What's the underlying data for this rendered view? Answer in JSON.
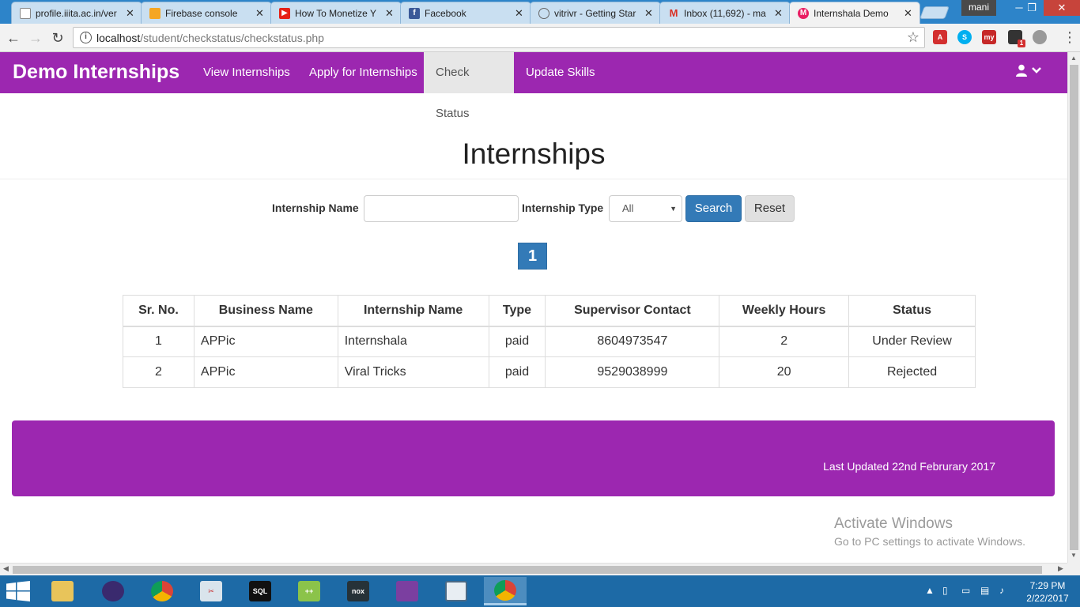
{
  "browser": {
    "tabs": [
      {
        "title": "profile.iiita.ac.in/ver",
        "icon": "page-icon",
        "active": false
      },
      {
        "title": "Firebase console",
        "icon": "firebase-icon",
        "active": false
      },
      {
        "title": "How To Monetize Y",
        "icon": "youtube-icon",
        "active": false
      },
      {
        "title": "Facebook",
        "icon": "facebook-icon",
        "active": false
      },
      {
        "title": "vitrivr - Getting Star",
        "icon": "search-icon",
        "active": false
      },
      {
        "title": "Inbox (11,692) - ma",
        "icon": "gmail-icon",
        "active": false
      },
      {
        "title": "Internshala Demo",
        "icon": "internshala-icon",
        "active": true
      }
    ],
    "user_chip": "mani",
    "url_host": "localhost",
    "url_path": "/student/checkstatus/checkstatus.php",
    "extension_badge": "1"
  },
  "navbar": {
    "brand": "Demo Internships",
    "links": [
      {
        "label": "View Internships",
        "active": false
      },
      {
        "label": "Apply for Internships",
        "active": false
      },
      {
        "label": "Check Status",
        "active": true
      },
      {
        "label": "Update Skills",
        "active": false
      }
    ]
  },
  "main": {
    "title": "Internships",
    "filter": {
      "name_label": "Internship Name",
      "name_value": "",
      "type_label": "Internship Type",
      "type_selected": "All",
      "search_label": "Search",
      "reset_label": "Reset"
    },
    "pagination": {
      "current_page": "1"
    },
    "table": {
      "headers": [
        "Sr. No.",
        "Business Name",
        "Internship Name",
        "Type",
        "Supervisor Contact",
        "Weekly Hours",
        "Status"
      ],
      "rows": [
        [
          "1",
          "APPic",
          "Internshala",
          "paid",
          "8604973547",
          "2",
          "Under Review"
        ],
        [
          "2",
          "APPic",
          "Viral Tricks",
          "paid",
          "9529038999",
          "20",
          "Rejected"
        ]
      ]
    }
  },
  "footer": {
    "text": "Last Updated 22nd Februrary 2017"
  },
  "watermark": {
    "title": "Activate Windows",
    "subtitle": "Go to PC settings to activate Windows."
  },
  "taskbar": {
    "time": "7:29 PM",
    "date": "2/22/2017",
    "apps": [
      "file-explorer-icon",
      "eclipse-icon",
      "chrome-icon",
      "snipping-tool-icon",
      "mysql-icon",
      "notepad-plus-plus-icon",
      "nox-icon",
      "winrar-icon",
      "reader-icon",
      "chrome-user-icon"
    ]
  },
  "colors": {
    "brand_purple": "#9c27b0",
    "primary_blue": "#337ab7",
    "taskbar_blue": "#1d6aa6"
  }
}
